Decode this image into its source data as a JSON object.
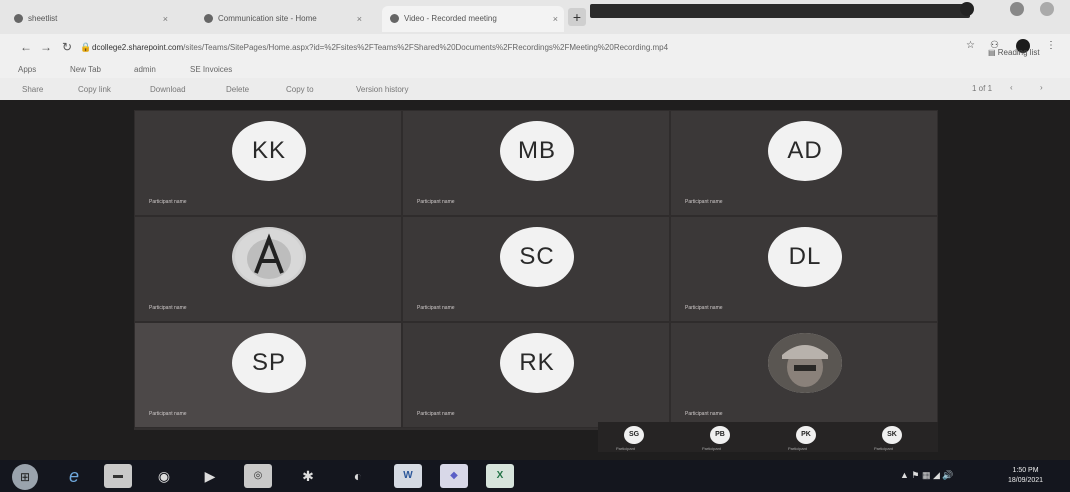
{
  "browser": {
    "tabs": [
      {
        "label": "sheetlist"
      },
      {
        "label": "Communication site - Home"
      },
      {
        "label": "Video - Recorded meeting"
      }
    ],
    "new_tab": "+",
    "url_domain": "dcollege2.sharepoint.com",
    "url_rest": "/sites/Teams/SitePages/Home.aspx?id=%2Fsites%2FTeams%2FShared%20Documents%2FRecordings%2FMeeting%20Recording.mp4",
    "reading_list": "Reading list",
    "bookmarks": [
      "Apps",
      "New Tab",
      "admin",
      "SE Invoices"
    ],
    "toolbar": [
      "Share",
      "Copy link",
      "Download",
      "Delete",
      "Copy to",
      "Version history"
    ],
    "pager": "1 of 1"
  },
  "participants": [
    {
      "initials": "KK",
      "caption": "Participant name"
    },
    {
      "initials": "MB",
      "caption": "Participant name"
    },
    {
      "initials": "AD",
      "caption": "Participant name"
    },
    {
      "initials": "",
      "caption": "Participant name"
    },
    {
      "initials": "SC",
      "caption": "Participant name"
    },
    {
      "initials": "DL",
      "caption": "Participant name"
    },
    {
      "initials": "SP",
      "caption": "Participant name"
    },
    {
      "initials": "RK",
      "caption": "Participant name"
    },
    {
      "initials": "",
      "caption": "Participant name"
    }
  ],
  "strip": [
    {
      "initials": "SG",
      "caption": "Participant"
    },
    {
      "initials": "PB",
      "caption": "Participant"
    },
    {
      "initials": "PK",
      "caption": "Participant"
    },
    {
      "initials": "SK",
      "caption": "Participant"
    }
  ],
  "taskbar": {
    "start": "⊞",
    "items": [
      "e",
      "▬",
      "◉",
      "▶",
      "◎",
      "✱",
      "◐",
      "W",
      "◆",
      "X"
    ],
    "tray": "▲ ⚑ ▦ ◢ 🔊",
    "time": "1:50 PM",
    "date": "18/09/2021"
  }
}
